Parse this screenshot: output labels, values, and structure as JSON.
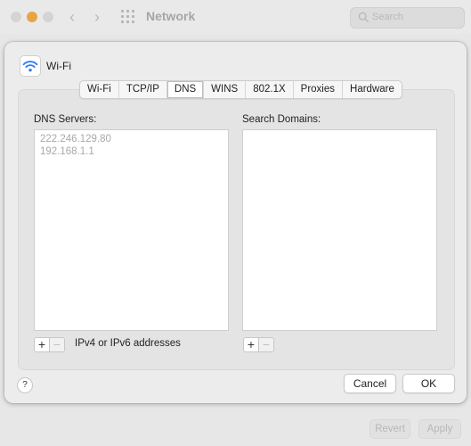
{
  "window": {
    "title": "Network",
    "search_placeholder": "Search",
    "revert_label": "Revert",
    "apply_label": "Apply"
  },
  "sheet": {
    "title": "Wi-Fi",
    "tabs": [
      {
        "label": "Wi-Fi",
        "active": false
      },
      {
        "label": "TCP/IP",
        "active": false
      },
      {
        "label": "DNS",
        "active": true
      },
      {
        "label": "WINS",
        "active": false
      },
      {
        "label": "802.1X",
        "active": false
      },
      {
        "label": "Proxies",
        "active": false
      },
      {
        "label": "Hardware",
        "active": false
      }
    ],
    "dns_label": "DNS Servers:",
    "dns_servers": [
      "222.246.129.80",
      "192.168.1.1"
    ],
    "search_domains_label": "Search Domains:",
    "search_domains": [],
    "add_symbol": "+",
    "remove_symbol": "−",
    "hint": "IPv4 or IPv6 addresses",
    "help_symbol": "?",
    "cancel_label": "Cancel",
    "ok_label": "OK"
  },
  "colors": {
    "traffic_light_minimize": "#e9a445",
    "wifi_icon": "#2f7cf6",
    "dns_text_dimmed": "#a9a9a9"
  },
  "icons": {
    "wifi": "wifi-icon",
    "search": "search-icon",
    "grid": "grid-icon"
  }
}
